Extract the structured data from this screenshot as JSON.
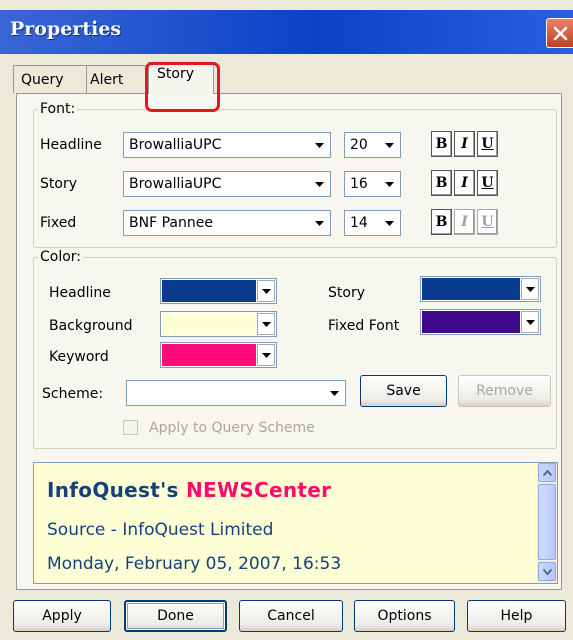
{
  "window": {
    "title": "Properties"
  },
  "tabs": [
    {
      "label": "Query",
      "selected": false
    },
    {
      "label": "Alert",
      "selected": false
    },
    {
      "label": "Story",
      "selected": true
    }
  ],
  "font_group": {
    "legend": "Font:",
    "rows": [
      {
        "label": "Headline",
        "font": "BrowalliaUPC",
        "size": "20"
      },
      {
        "label": "Story",
        "font": "BrowalliaUPC",
        "size": "16"
      },
      {
        "label": "Fixed",
        "font": "BNF Pannee",
        "size": "14"
      }
    ],
    "style_buttons": {
      "bold": "B",
      "italic": "I",
      "underline": "U"
    }
  },
  "color_group": {
    "legend": "Color:",
    "headline": {
      "label": "Headline",
      "color": "#0b3b8c"
    },
    "background": {
      "label": "Background",
      "color": "#ffffd5"
    },
    "keyword": {
      "label": "Keyword",
      "color": "#ff0a78"
    },
    "story": {
      "label": "Story",
      "color": "#0b3b8c"
    },
    "fixed_font": {
      "label": "Fixed Font",
      "color": "#3f0a8c"
    },
    "scheme": {
      "label": "Scheme:",
      "value": ""
    },
    "save_label": "Save",
    "remove_label": "Remove",
    "apply_query_scheme": {
      "label": "Apply to Query Scheme",
      "checked": false,
      "enabled": false
    }
  },
  "preview": {
    "title_part1": "InfoQuest's ",
    "title_part2": "NEWSCenter",
    "line1": "Source - InfoQuest Limited",
    "line2": "Monday, February 05, 2007, 16:53"
  },
  "buttons": {
    "apply": "Apply",
    "done": "Done",
    "cancel": "Cancel",
    "options": "Options",
    "help": "Help"
  }
}
